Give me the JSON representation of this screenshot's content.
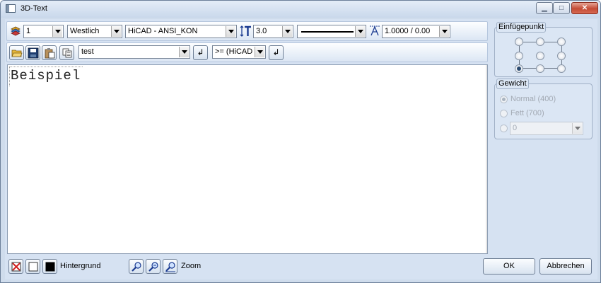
{
  "window": {
    "title": "3D-Text"
  },
  "toolbar1": {
    "layer_value": "1",
    "orientation_value": "Westlich",
    "font_value": "HiCAD - ANSI_KON",
    "height_value": "3.0",
    "ratio_value": "1.0000 / 0.00"
  },
  "toolbar2": {
    "template_value": "test",
    "mode_value": ">= (HiCAD"
  },
  "editor": {
    "text": "Beispiel"
  },
  "bottom": {
    "background_label": "Hintergrund",
    "zoom_label": "Zoom"
  },
  "insertion_point": {
    "title": "Einfügepunkt"
  },
  "weight": {
    "title": "Gewicht",
    "normal_label": "Normal (400)",
    "bold_label": "Fett (700)",
    "custom_value": "0"
  },
  "buttons": {
    "ok_label": "OK",
    "cancel_label": "Abbrechen"
  },
  "colors": {
    "accent": "#cfdcec",
    "close": "#c44b35"
  }
}
